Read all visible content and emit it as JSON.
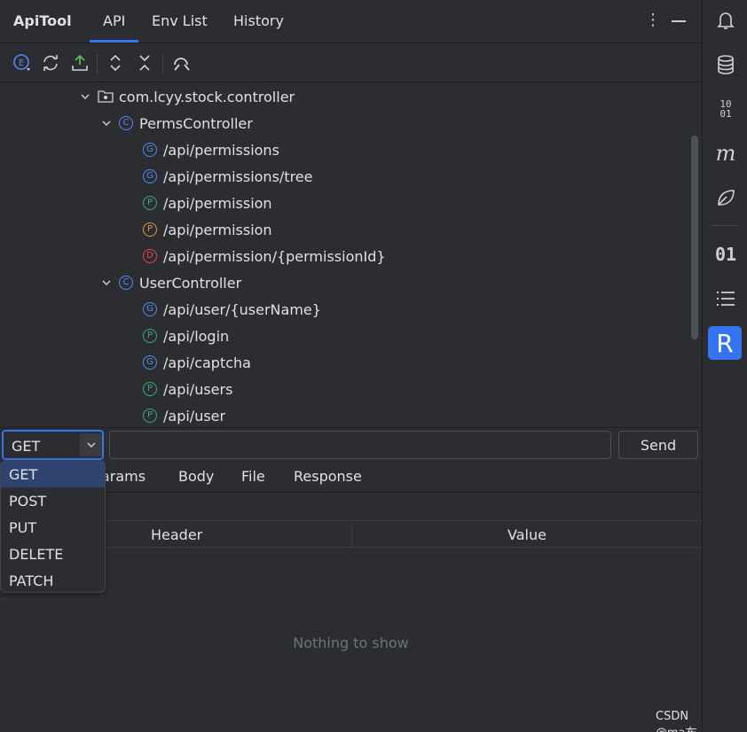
{
  "header": {
    "app_title": "ApiTool",
    "tabs": [
      "API",
      "Env List",
      "History"
    ],
    "active_tab": "API"
  },
  "toolbar": {
    "icons": [
      "env-icon",
      "refresh-icon",
      "export-icon",
      "expand-all-icon",
      "collapse-all-icon",
      "search-icon"
    ]
  },
  "tree": {
    "package": "com.lcyy.stock.controller",
    "controllers": [
      {
        "name": "PermsController",
        "badge": "C",
        "endpoints": [
          {
            "method": "G",
            "path": "/api/permissions"
          },
          {
            "method": "G",
            "path": "/api/permissions/tree"
          },
          {
            "method": "P",
            "path": "/api/permission"
          },
          {
            "method": "P",
            "path": "/api/permission"
          },
          {
            "method": "D",
            "path": "/api/permission/{permissionId}"
          }
        ]
      },
      {
        "name": "UserController",
        "badge": "C",
        "endpoints": [
          {
            "method": "G",
            "path": "/api/user/{userName}"
          },
          {
            "method": "P",
            "path": "/api/login"
          },
          {
            "method": "G",
            "path": "/api/captcha"
          },
          {
            "method": "P",
            "path": "/api/users"
          },
          {
            "method": "P",
            "path": "/api/user"
          }
        ]
      }
    ]
  },
  "request": {
    "method": "GET",
    "url_value": "",
    "send_label": "Send"
  },
  "method_options": [
    "GET",
    "POST",
    "PUT",
    "DELETE",
    "PATCH"
  ],
  "subtabs": [
    "Params",
    "Body",
    "File",
    "Response"
  ],
  "table": {
    "columns": [
      "Header",
      "Value"
    ],
    "empty_text": "Nothing to show"
  },
  "right_bar": {
    "icons": [
      "notifications-icon",
      "database-icon",
      "binary-icon",
      "maven-icon",
      "leaf-icon",
      "binary-01-icon",
      "list-icon",
      "r-plugin-icon"
    ],
    "binary_label": "01",
    "r_label": "R"
  },
  "watermark": "CSDN @ma布",
  "colors": {
    "accent": "#3574f0",
    "get": "#548af7",
    "post": "#3aa88b",
    "put": "#e09b3d",
    "delete": "#e5484d"
  }
}
